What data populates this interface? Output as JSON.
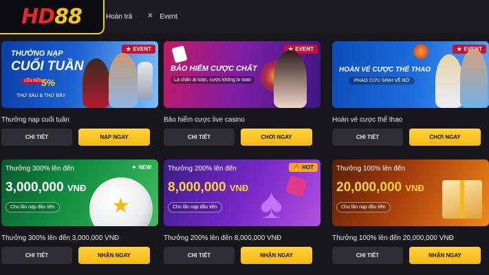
{
  "header": {
    "logo": {
      "hd": "HD",
      "num": "88"
    },
    "nav": [
      {
        "label": "Hoàn trả",
        "icon": "none"
      },
      {
        "label": "Event",
        "icon": "x-icon"
      }
    ]
  },
  "cards": [
    {
      "title": "Thưởng nạp cuối tuần",
      "tag": "EVENT",
      "banner": {
        "line1": "THƯỞNG NẠP",
        "line2": "CUỐI TUẦN",
        "badge": "LÊN ĐẾN",
        "percent": "5%",
        "days": "THỨ SÁU & THỨ BẢY"
      },
      "detail_label": "CHI TIẾT",
      "action_label": "NẠP NGAY"
    },
    {
      "title": "Bảo hiểm cược live casino",
      "tag": "EVENT",
      "banner": {
        "line1": "BẢO HIỂM CƯỢC CHẤT",
        "sub": "Là chân ái toàn, cược không lo toan"
      },
      "detail_label": "CHI TIẾT",
      "action_label": "CHƠI NGAY"
    },
    {
      "title": "Hoàn vé cược thể thao",
      "tag": "EVENT",
      "banner": {
        "line1": "HOÀN VÉ CƯỢC THỂ THAO",
        "sub": "PHAO CỨU SINH VỀ BỜ"
      },
      "detail_label": "CHI TIẾT",
      "action_label": "CHƠI NGAY"
    },
    {
      "title": "Thưởng 300% lên đến 3,000,000 VNĐ",
      "tag": "NEW",
      "banner": {
        "caption": "Thưởng 300% lên đến",
        "amount": "3,000,000",
        "currency": "VNĐ",
        "pill": "Cho lần nạp đầu tiên"
      },
      "detail_label": "CHI TIẾT",
      "action_label": "NHẬN NGAY"
    },
    {
      "title": "Thưởng 200% lên đến 8,000,000 VNĐ",
      "tag": "HOT",
      "banner": {
        "caption": "Thưởng 200% lên đến",
        "amount": "8,000,000",
        "currency": "VNĐ",
        "pill": "Cho lần nạp đầu tiên"
      },
      "detail_label": "CHI TIẾT",
      "action_label": "NHẬN NGAY"
    },
    {
      "title": "Thưởng 100% lên đến 20,000,000 VNĐ",
      "tag": "",
      "banner": {
        "caption": "Thưởng 100% lên đến",
        "amount": "20,000,000",
        "currency": "VNĐ",
        "pill": "Cho lần nạp đầu tiên"
      },
      "detail_label": "CHI TIẾT",
      "action_label": "NHẬN NGAY"
    }
  ],
  "colors": {
    "accent": "#f5c518",
    "brand_red": "#e8242c",
    "background": "#16161c"
  }
}
